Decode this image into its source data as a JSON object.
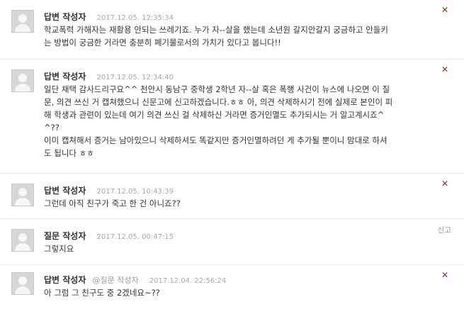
{
  "comments": [
    {
      "author": "답변 작성자",
      "mention": "",
      "date": "2017.12.05. 12:35:34",
      "lines": [
        "학교폭력 가해자는 재활용 안되는 쓰레기죠. 누가 자--살을 했는데 소년원 갈지안갈지 궁금하고 안들키",
        "는 방법이 궁금한 거라면 충분히 폐기물로서의 가치가 있다고 봅니다!!"
      ],
      "action": "✕"
    },
    {
      "author": "답변 작성자",
      "mention": "",
      "date": "2017.12.05. 12:34:40",
      "lines": [
        "일단 채택 감사드리구요^^ 천안시 동남구 중학생 2학년 자--살 혹은 폭행 사건이 뉴스에 나오면 이 질",
        "문, 의견 쓰신 거 캡쳐했으니 신문고에 신고하겠습니다.ㅎㅎ 아, 의견 삭제하시기 전에 실제로 본인이 피",
        "해 학생과 관련이 있는데 여기 의견 쓰신 걸 삭제하신 거라면 증거인멸도 추가되시는 거 알고계시죠^",
        "^??",
        "이미 캡쳐해서 증거는 남아있으니 삭제하셔도 똑같지만 증거인멸하려던 게 추가될 뿐이니 맘대로 하셔",
        "도 됩니다 ㅎㅎ"
      ],
      "action": "✕"
    },
    {
      "author": "답변 작성자",
      "mention": "",
      "date": "2017.12.05. 10:43:39",
      "lines": [
        "그런데 아직 친구가 죽고 한 건 아니죠??"
      ],
      "action": "✕"
    },
    {
      "author": "질문 작성자",
      "mention": "",
      "date": "2017.12.05. 00:47:15",
      "lines": [
        "그렇지요"
      ],
      "action": "신고"
    },
    {
      "author": "답변 작성자",
      "mention": "@질문 작성자",
      "date": "2017.12.04. 22:56:24",
      "lines": [
        "아 그럼 그 친구도 중 2겠네요~??"
      ],
      "action": "✕"
    }
  ]
}
